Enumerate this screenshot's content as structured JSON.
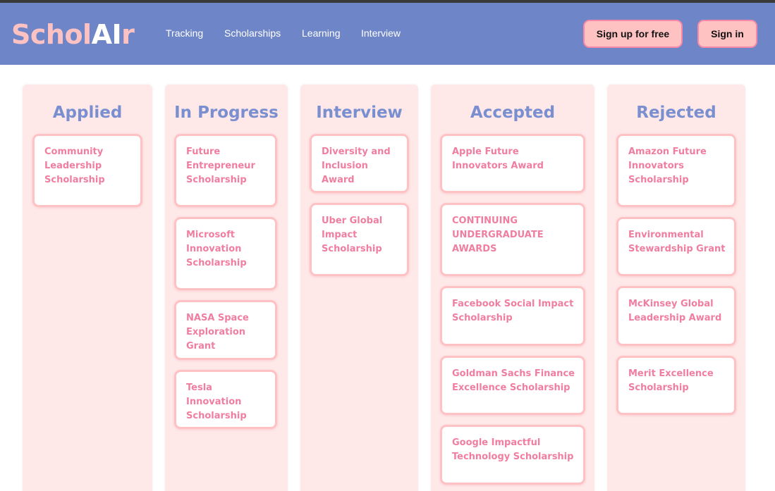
{
  "brand": {
    "part1": "Schol",
    "part2": "AI",
    "part3": "r"
  },
  "nav": {
    "links": [
      "Tracking",
      "Scholarships",
      "Learning",
      "Interview"
    ],
    "signup_label": "Sign up for free",
    "signin_label": "Sign in"
  },
  "board": {
    "columns": [
      {
        "title": "Applied",
        "cards": [
          "Community Leadership Scholarship"
        ]
      },
      {
        "title": "In Progress",
        "cards": [
          "Future Entrepreneur Scholarship",
          "Microsoft Innovation Scholarship",
          "NASA Space Exploration Grant",
          "Tesla Innovation Scholarship"
        ]
      },
      {
        "title": "Interview",
        "cards": [
          "Diversity and Inclusion Award",
          "Uber Global Impact Scholarship"
        ]
      },
      {
        "title": "Accepted",
        "cards": [
          "Apple Future Innovators Award",
          "CONTINUING UNDERGRADUATE AWARDS",
          "Facebook Social Impact Scholarship",
          "Goldman Sachs Finance Excellence Scholarship",
          "Google Impactful Technology Scholarship"
        ]
      },
      {
        "title": "Rejected",
        "cards": [
          "Amazon Future Innovators Scholarship",
          "Environmental Stewardship Grant",
          "McKinsey Global Leadership Award",
          "Merit Excellence Scholarship"
        ]
      }
    ]
  },
  "colors": {
    "navbar": "#6e86c8",
    "brand_pink": "#ffc2c2",
    "column_bg": "#ffe8e8",
    "column_title": "#7a8fcf",
    "card_border": "#ffc2c4",
    "card_text": "#f07ea0"
  }
}
